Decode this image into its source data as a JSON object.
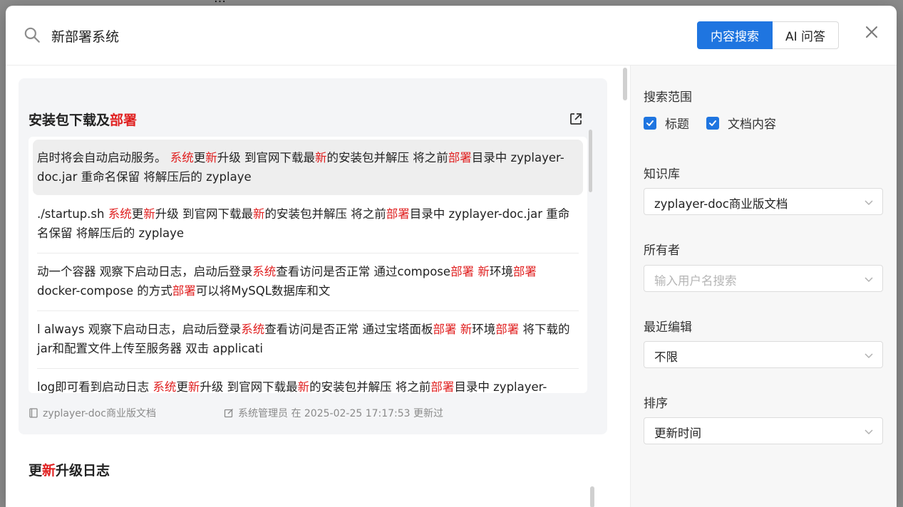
{
  "search": {
    "query": "新部署系统",
    "modes": [
      "内容搜索",
      "AI 问答"
    ]
  },
  "results": [
    {
      "title_parts": [
        {
          "text": "安装包下载及",
          "hl": false
        },
        {
          "text": "部署",
          "hl": true
        }
      ],
      "snippets": [
        [
          {
            "text": "启时将会自动启动服务。 ",
            "hl": false
          },
          {
            "text": "系统",
            "hl": true
          },
          {
            "text": "更",
            "hl": false
          },
          {
            "text": "新",
            "hl": true
          },
          {
            "text": "升级 到官网下载最",
            "hl": false
          },
          {
            "text": "新",
            "hl": true
          },
          {
            "text": "的安装包并解压 将之前",
            "hl": false
          },
          {
            "text": "部署",
            "hl": true
          },
          {
            "text": "目录中 zyplayer-doc.jar 重命名保留 将解压后的 zyplaye",
            "hl": false
          }
        ],
        [
          {
            "text": "./startup.sh ",
            "hl": false
          },
          {
            "text": "系统",
            "hl": true
          },
          {
            "text": "更",
            "hl": false
          },
          {
            "text": "新",
            "hl": true
          },
          {
            "text": "升级 到官网下载最",
            "hl": false
          },
          {
            "text": "新",
            "hl": true
          },
          {
            "text": "的安装包并解压 将之前",
            "hl": false
          },
          {
            "text": "部署",
            "hl": true
          },
          {
            "text": "目录中 zyplayer-doc.jar 重命名保留 将解压后的 zyplaye",
            "hl": false
          }
        ],
        [
          {
            "text": "动一个容器 观察下启动日志，启动后登录",
            "hl": false
          },
          {
            "text": "系统",
            "hl": true
          },
          {
            "text": "查看访问是否正常 通过compose",
            "hl": false
          },
          {
            "text": "部署",
            "hl": true
          },
          {
            "text": " ",
            "hl": false
          },
          {
            "text": "新",
            "hl": true
          },
          {
            "text": "环境",
            "hl": false
          },
          {
            "text": "部署",
            "hl": true
          },
          {
            "text": " docker-compose 的方式",
            "hl": false
          },
          {
            "text": "部署",
            "hl": true
          },
          {
            "text": "可以将MySQL数据库和文",
            "hl": false
          }
        ],
        [
          {
            "text": "l always 观察下启动日志，启动后登录",
            "hl": false
          },
          {
            "text": "系统",
            "hl": true
          },
          {
            "text": "查看访问是否正常 通过宝塔面板",
            "hl": false
          },
          {
            "text": "部署",
            "hl": true
          },
          {
            "text": " ",
            "hl": false
          },
          {
            "text": "新",
            "hl": true
          },
          {
            "text": "环境",
            "hl": false
          },
          {
            "text": "部署",
            "hl": true
          },
          {
            "text": " 将下载的jar和配置文件上传至服务器 双击 applicati",
            "hl": false
          }
        ],
        [
          {
            "text": "log即可看到启动日志 ",
            "hl": false
          },
          {
            "text": "系统",
            "hl": true
          },
          {
            "text": "更",
            "hl": false
          },
          {
            "text": "新",
            "hl": true
          },
          {
            "text": "升级 到官网下载最",
            "hl": false
          },
          {
            "text": "新",
            "hl": true
          },
          {
            "text": "的安装包并解压 将之前",
            "hl": false
          },
          {
            "text": "部署",
            "hl": true
          },
          {
            "text": "目录中 zyplayer-",
            "hl": false
          }
        ]
      ],
      "space": "zyplayer-doc商业版文档",
      "editor_info": "系统管理员 在 2025-02-25 17:17:53 更新过"
    },
    {
      "title_parts": [
        {
          "text": "更",
          "hl": false
        },
        {
          "text": "新",
          "hl": true
        },
        {
          "text": "升级日志",
          "hl": false
        }
      ]
    }
  ],
  "filters": {
    "scope_label": "搜索范围",
    "scope_options": [
      {
        "label": "标题",
        "checked": true
      },
      {
        "label": "文档内容",
        "checked": true
      }
    ],
    "kb_label": "知识库",
    "kb_value": "zyplayer-doc商业版文档",
    "owner_label": "所有者",
    "owner_placeholder": "输入用户名搜索",
    "recent_label": "最近编辑",
    "recent_value": "不限",
    "sort_label": "排序",
    "sort_value": "更新时间"
  },
  "colors": {
    "accent": "#1f75e0",
    "highlight": "#e02020"
  }
}
